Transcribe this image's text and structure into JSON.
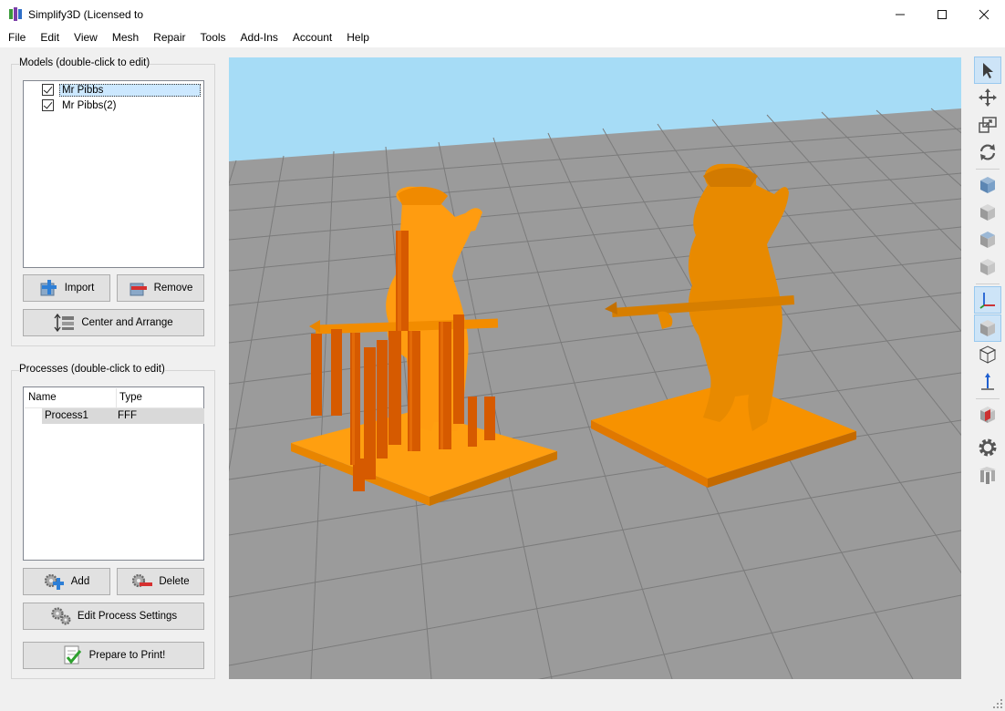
{
  "window": {
    "title": "Simplify3D (Licensed to",
    "minimize_icon": "minimize-icon",
    "maximize_icon": "maximize-icon",
    "close_icon": "close-icon"
  },
  "menu": [
    "File",
    "Edit",
    "View",
    "Mesh",
    "Repair",
    "Tools",
    "Add-Ins",
    "Account",
    "Help"
  ],
  "models_panel": {
    "title": "Models (double-click to edit)",
    "items": [
      {
        "label": "Mr Pibbs",
        "checked": true,
        "selected": true
      },
      {
        "label": "Mr Pibbs(2)",
        "checked": true,
        "selected": false
      }
    ],
    "import_label": "Import",
    "remove_label": "Remove",
    "center_label": "Center and Arrange"
  },
  "processes_panel": {
    "title": "Processes (double-click to edit)",
    "columns": [
      "Name",
      "Type"
    ],
    "rows": [
      {
        "name": "Process1",
        "type": "FFF"
      }
    ],
    "add_label": "Add",
    "delete_label": "Delete",
    "edit_label": "Edit Process Settings",
    "prepare_label": "Prepare to Print!"
  },
  "toolbar": [
    {
      "icon": "pointer-icon",
      "active": true
    },
    {
      "icon": "move-icon",
      "active": false
    },
    {
      "icon": "scale-icon",
      "active": false
    },
    {
      "icon": "rotate-icon",
      "active": false
    },
    {
      "icon": "view-front-icon",
      "active": false
    },
    {
      "icon": "view-side-icon",
      "active": false
    },
    {
      "icon": "view-top-icon",
      "active": false
    },
    {
      "icon": "view-iso-icon",
      "active": false
    },
    {
      "icon": "axes-icon",
      "active": true
    },
    {
      "icon": "solid-view-icon",
      "active": true
    },
    {
      "icon": "wireframe-icon",
      "active": false
    },
    {
      "icon": "normals-icon",
      "active": false
    },
    {
      "icon": "cross-section-icon",
      "active": false
    },
    {
      "icon": "settings-gear-icon",
      "active": false
    },
    {
      "icon": "support-structures-icon",
      "active": false
    }
  ],
  "colors": {
    "model": "#ff9900",
    "support": "#dd5500",
    "grid": "#9a9a9a",
    "sky": "#a6dcf6",
    "accent": "#cde4f7"
  }
}
